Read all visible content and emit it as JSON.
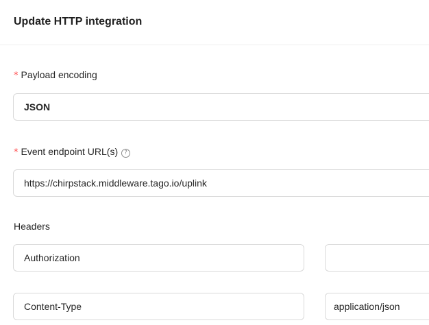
{
  "header": {
    "title": "Update HTTP integration"
  },
  "payload_encoding": {
    "required_mark": "*",
    "label": "Payload encoding",
    "value": "JSON"
  },
  "event_endpoint": {
    "required_mark": "*",
    "label": "Event endpoint URL(s)",
    "help_glyph": "?",
    "value": "https://chirpstack.middleware.tago.io/uplink"
  },
  "headers": {
    "label": "Headers",
    "rows": [
      {
        "key": "Authorization",
        "value": ""
      },
      {
        "key": "Content-Type",
        "value": "application/json"
      }
    ]
  },
  "colors": {
    "required": "#ff4d4f",
    "border": "#d9d9d9",
    "text": "#262626"
  }
}
